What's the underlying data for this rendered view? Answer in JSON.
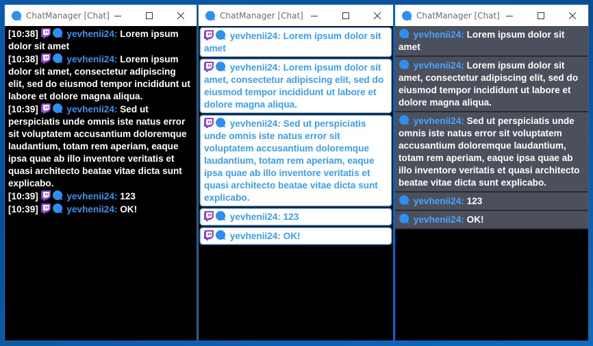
{
  "windows": [
    {
      "title": "ChatManager [Chat]"
    },
    {
      "title": "ChatManager [Chat]"
    },
    {
      "title": "ChatManager [Chat]"
    }
  ],
  "messages": [
    {
      "time": "[10:38]",
      "user": "yevhenii24:",
      "text": "Lorem ipsum dolor sit amet"
    },
    {
      "time": "[10:38]",
      "user": "yevhenii24:",
      "text": "Lorem ipsum dolor sit amet, consectetur adipiscing elit, sed do eiusmod tempor incididunt ut labore et dolore magna aliqua."
    },
    {
      "time": "[10:39]",
      "user": "yevhenii24:",
      "text": "Sed ut perspiciatis unde omnis iste natus error sit voluptatem accusantium doloremque laudantium, totam rem aperiam, eaque ipsa quae ab illo inventore veritatis et quasi architecto beatae vitae dicta sunt explicabo."
    },
    {
      "time": "[10:39]",
      "user": "yevhenii24:",
      "text": "123"
    },
    {
      "time": "[10:39]",
      "user": "yevhenii24:",
      "text": "OK!"
    }
  ],
  "icons": {
    "platform": "twitch-icon",
    "app": "chat-bubble-icon",
    "minimize": "minimize-icon",
    "maximize": "maximize-icon",
    "close": "close-icon"
  },
  "colors": {
    "username": "#3a8fe8",
    "twitch": "#8a45c9",
    "bubble": "#2d8ff0",
    "card_text": "#3a9ff0",
    "dark_card": "#4c4f5c"
  }
}
